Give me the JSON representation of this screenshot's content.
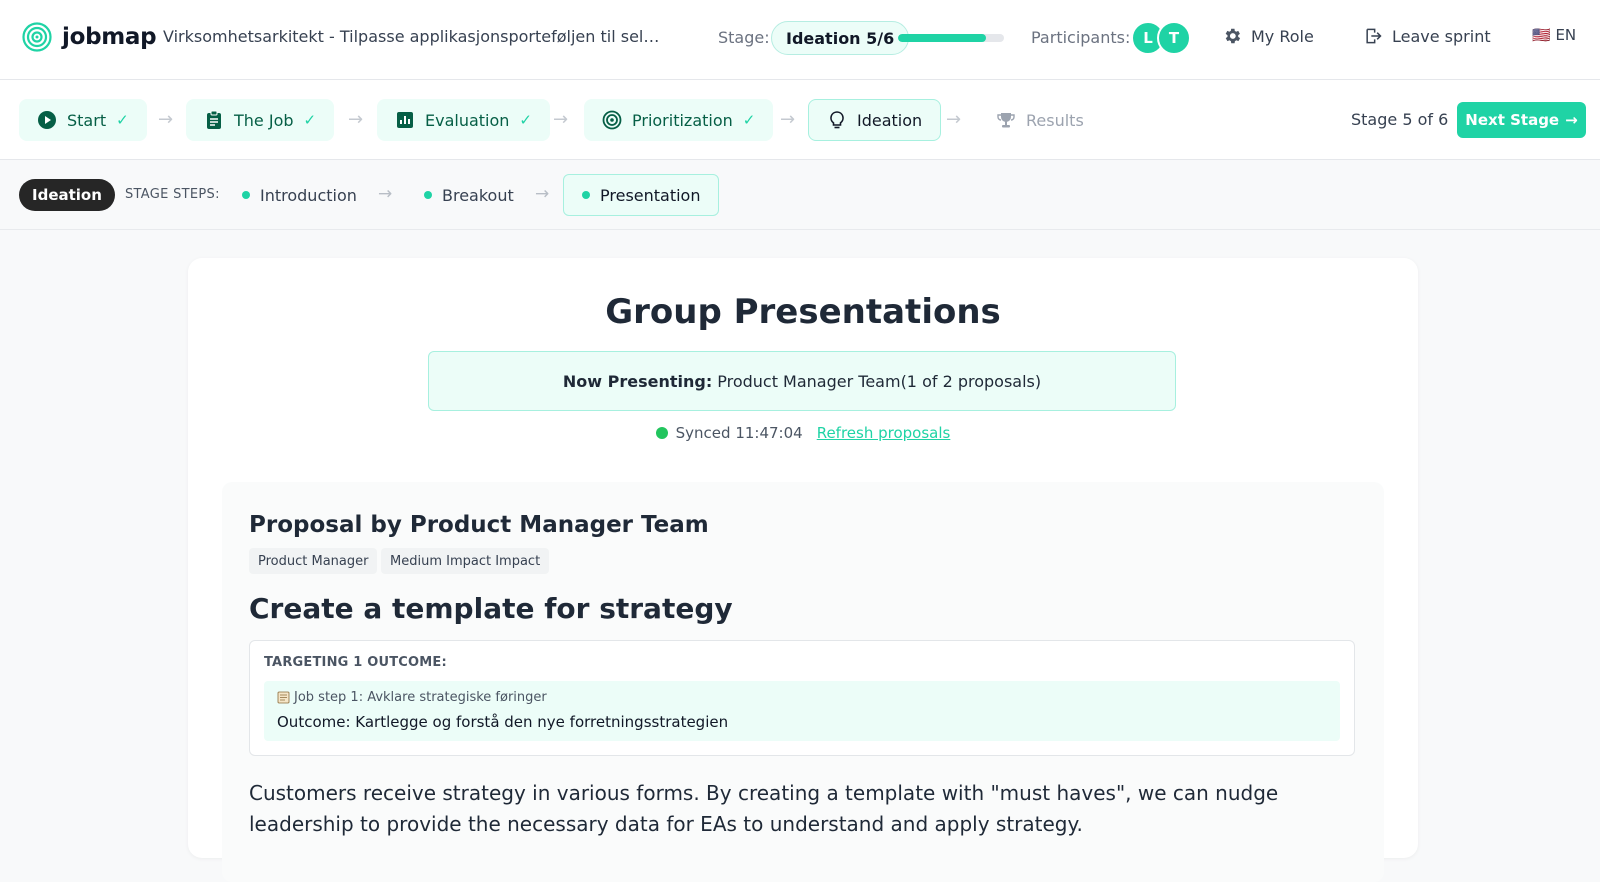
{
  "app": {
    "name": "jobmap"
  },
  "header": {
    "sprint_title": "Virksomhetsarkitekt - Tilpasse applikasjonsporteføljen til selskapsst...",
    "stage_label": "Stage:",
    "stage_value": "Ideation 5/6",
    "stage_progress": 0.83,
    "participants_label": "Participants:",
    "participants": [
      "L",
      "T"
    ],
    "my_role": "My Role",
    "leave_sprint": "Leave sprint",
    "language": "🇺🇸 EN"
  },
  "stages": [
    {
      "label": "Start",
      "status": "done"
    },
    {
      "label": "The Job",
      "status": "done"
    },
    {
      "label": "Evaluation",
      "status": "done"
    },
    {
      "label": "Prioritization",
      "status": "done"
    },
    {
      "label": "Ideation",
      "status": "active"
    },
    {
      "label": "Results",
      "status": "future"
    }
  ],
  "stage_count": "Stage 5 of 6",
  "next_stage": "Next Stage",
  "steps": {
    "current": "Ideation",
    "label": "STAGE STEPS:",
    "items": [
      "Introduction",
      "Breakout",
      "Presentation"
    ],
    "active": "Presentation"
  },
  "main": {
    "title": "Group Presentations",
    "now_presenting_label": "Now Presenting:",
    "now_presenting_value": "Product Manager Team(1 of 2 proposals)",
    "synced": "Synced 11:47:04",
    "refresh": "Refresh proposals",
    "proposal": {
      "by": "Proposal by Product Manager Team",
      "tags": [
        "Product Manager",
        "Medium Impact Impact"
      ],
      "title": "Create a template for strategy",
      "targeting": "TARGETING 1 OUTCOME:",
      "job_step": "Job step 1: Avklare strategiske føringer",
      "outcome": "Outcome: Kartlegge og forstå den nye forretningsstrategien",
      "description": "Customers receive strategy in various forms. By creating a template with \"must haves\", we can nudge leadership to provide the necessary data for EAs to understand and apply strategy."
    }
  },
  "colors": {
    "accent": "#1fd3a5",
    "accent_light": "#ecfdf8",
    "sync": "#22c55e"
  }
}
